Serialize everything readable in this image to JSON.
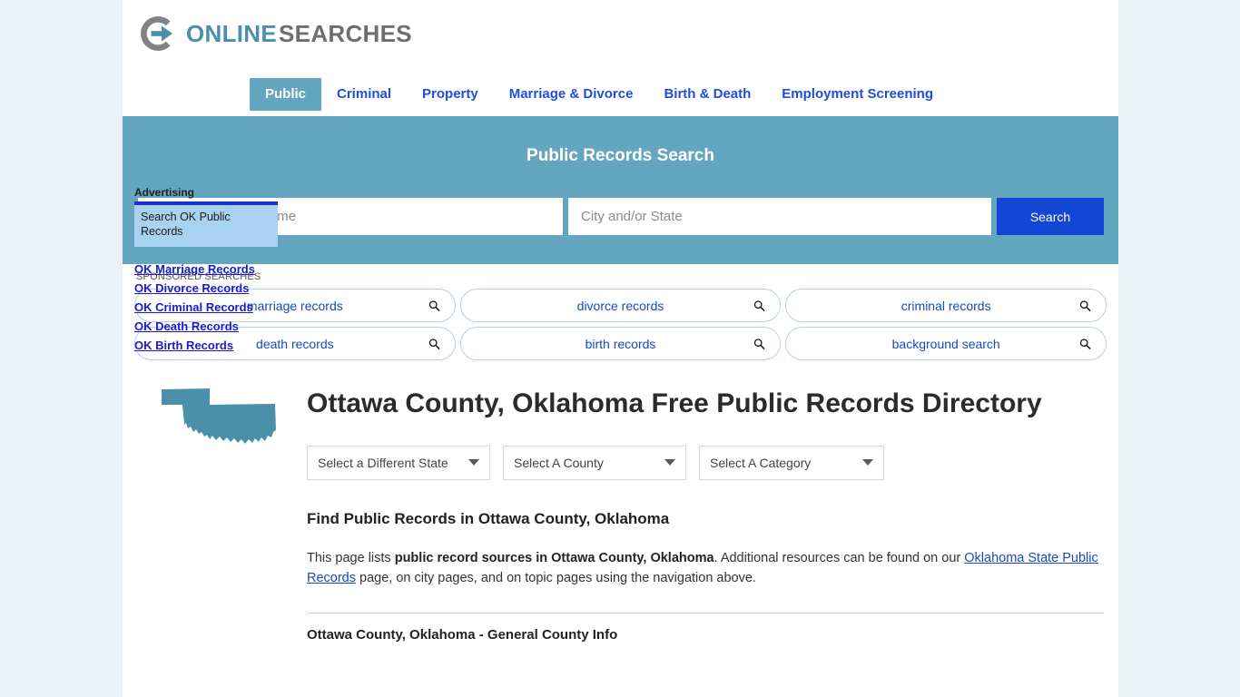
{
  "brand": {
    "logo_icon": "circle-arrow-icon",
    "name_part1": "ONLINE",
    "name_part2": "SEARCHES",
    "color_blue": "#4a90ab",
    "color_gray": "#6d6e71"
  },
  "nav": {
    "tabs": [
      {
        "label": "Public",
        "active": true
      },
      {
        "label": "Criminal",
        "active": false
      },
      {
        "label": "Property",
        "active": false
      },
      {
        "label": "Marriage & Divorce",
        "active": false
      },
      {
        "label": "Birth & Death",
        "active": false
      },
      {
        "label": "Employment Screening",
        "active": false
      }
    ],
    "active_bg": "#64a5c0",
    "link_color": "#1f4ed8"
  },
  "search": {
    "title": "Public Records Search",
    "name_placeholder": "Enter First & Last Name",
    "name_value": "",
    "city_placeholder": "City and/or State",
    "city_value": "",
    "button_label": "Search",
    "band_color": "#64a5c0",
    "button_color": "#1446d6"
  },
  "sponsored": {
    "label": "SPONSORED SEARCHES",
    "items": [
      {
        "label": "marriage records",
        "icon": "search-icon"
      },
      {
        "label": "divorce records",
        "icon": "search-icon"
      },
      {
        "label": "criminal records",
        "icon": "search-icon"
      },
      {
        "label": "death records",
        "icon": "search-icon"
      },
      {
        "label": "birth records",
        "icon": "search-icon"
      },
      {
        "label": "background search",
        "icon": "search-icon"
      }
    ]
  },
  "main": {
    "state_icon": "oklahoma-state-map-icon",
    "state_icon_color": "#4a90ab",
    "title": "Ottawa County, Oklahoma Free Public Records Directory",
    "selects": [
      {
        "value": "Select a Different State"
      },
      {
        "value": "Select A County"
      },
      {
        "value": "Select A Category"
      }
    ],
    "section_heading": "Find Public Records in Ottawa County, Oklahoma",
    "intro_prefix": "This page lists ",
    "intro_bold": "public record sources in Ottawa County, Oklahoma",
    "intro_middle": ". Additional resources can be found on our ",
    "intro_link": "Oklahoma State Public Records",
    "intro_suffix": " page, on city pages, and on topic pages using the navigation above.",
    "subsection_heading": "Ottawa County, Oklahoma - General County Info"
  },
  "sidebar": {
    "advertising_label": "Advertising",
    "ad_text": "Search OK Public Records",
    "ad_bg": "#a9d1f0",
    "links": [
      {
        "label": "OK Marriage Records"
      },
      {
        "label": "OK Divorce Records"
      },
      {
        "label": "OK Criminal Records"
      },
      {
        "label": "OK Death Records"
      },
      {
        "label": "OK Birth Records"
      }
    ]
  }
}
